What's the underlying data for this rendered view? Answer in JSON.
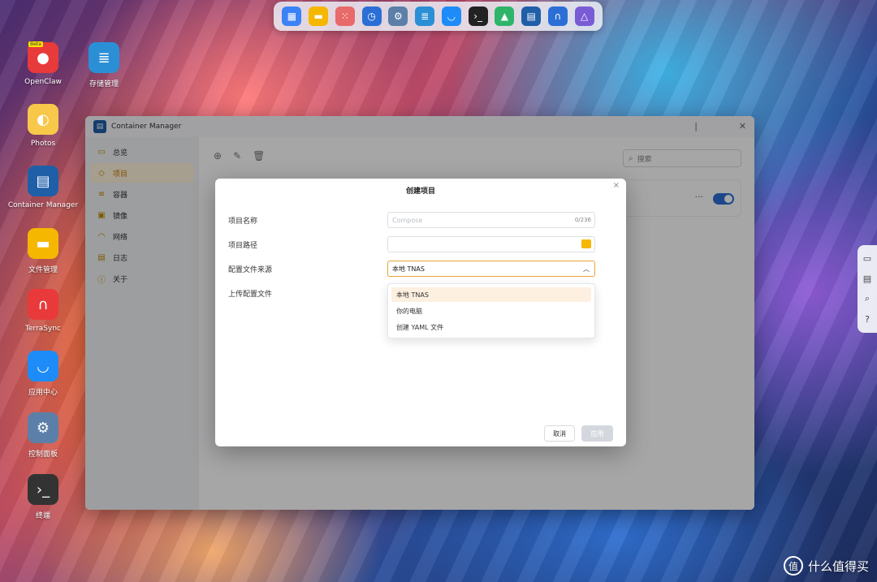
{
  "dock": {
    "items": [
      {
        "name": "dashboard",
        "glyph": "▦",
        "color": "#3b82f6"
      },
      {
        "name": "notes",
        "glyph": "▬",
        "color": "#f5b700"
      },
      {
        "name": "apps",
        "glyph": "⁙",
        "color": "#e86a6a"
      },
      {
        "name": "backup",
        "glyph": "◷",
        "color": "#2b6fd6"
      },
      {
        "name": "settings",
        "glyph": "⚙",
        "color": "#5b7fa8"
      },
      {
        "name": "storage",
        "glyph": "≣",
        "color": "#2b8fd6"
      },
      {
        "name": "app-center",
        "glyph": "◡",
        "color": "#1d8cf8"
      },
      {
        "name": "terminal",
        "glyph": "›_",
        "color": "#222222"
      },
      {
        "name": "tree",
        "glyph": "▲",
        "color": "#2fb56a"
      },
      {
        "name": "docker",
        "glyph": "▤",
        "color": "#1f5fa8"
      },
      {
        "name": "headphones",
        "glyph": "∩",
        "color": "#2b6fd6"
      },
      {
        "name": "vpn",
        "glyph": "△",
        "color": "#7a5bd6"
      }
    ]
  },
  "desktop": {
    "icons": [
      {
        "label": "OpenClaw",
        "glyph": "●",
        "color": "#e83a3a",
        "beta": "Beta"
      },
      {
        "label": "存储管理",
        "glyph": "≣",
        "color": "#2b8fd6"
      },
      {
        "label": "Photos",
        "glyph": "◐",
        "color": "#f7c84a"
      },
      {
        "label": "Container Manager",
        "glyph": "▤",
        "color": "#1f5fa8"
      },
      {
        "label": "文件管理",
        "glyph": "▬",
        "color": "#f5b700"
      },
      {
        "label": "TerraSync",
        "glyph": "∩",
        "color": "#e83a3a"
      },
      {
        "label": "应用中心",
        "glyph": "◡",
        "color": "#1d8cf8"
      },
      {
        "label": "控制面板",
        "glyph": "⚙",
        "color": "#5b7fa8"
      },
      {
        "label": "终端",
        "glyph": "›_",
        "color": "#333333"
      }
    ]
  },
  "window": {
    "title": "Container Manager",
    "nav": [
      {
        "label": "总览",
        "icon": "▭"
      },
      {
        "label": "项目",
        "icon": "◇"
      },
      {
        "label": "容器",
        "icon": "≡"
      },
      {
        "label": "镜像",
        "icon": "▣"
      },
      {
        "label": "网络",
        "icon": "◠"
      },
      {
        "label": "日志",
        "icon": "▤"
      },
      {
        "label": "关于",
        "icon": "ⓘ"
      }
    ],
    "search_placeholder": "搜索",
    "row_more": "···"
  },
  "dialog": {
    "title": "创建项目",
    "close": "×",
    "fields": {
      "name_label": "项目名称",
      "name_placeholder": "Compose",
      "name_count": "0/236",
      "path_label": "项目路径",
      "source_label": "配置文件来源",
      "source_value": "本地 TNAS",
      "upload_label": "上传配置文件"
    },
    "options": [
      "本地 TNAS",
      "你的电脑",
      "创建 YAML 文件"
    ],
    "cancel": "取消",
    "apply": "应用"
  },
  "side_tools": [
    "▭",
    "▤",
    "⌕",
    "?"
  ],
  "watermark": {
    "glyph": "值",
    "text": "什么值得买"
  }
}
